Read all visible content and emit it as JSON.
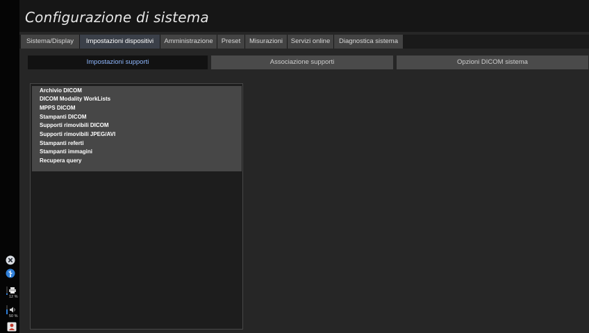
{
  "window": {
    "title": "Configurazione di sistema"
  },
  "tabs": [
    {
      "label": "Sistema/Display",
      "active": false
    },
    {
      "label": "Impostazioni dispositivi",
      "active": true
    },
    {
      "label": "Amministrazione",
      "active": false
    },
    {
      "label": "Preset",
      "active": false
    },
    {
      "label": "Misurazioni",
      "active": false
    },
    {
      "label": "Servizi online",
      "active": false
    },
    {
      "label": "Diagnostica sistema",
      "active": false
    }
  ],
  "subtabs": [
    {
      "label": "Impostazioni supporti",
      "active": true
    },
    {
      "label": "Associazione supporti",
      "active": false
    },
    {
      "label": "Opzioni DICOM sistema",
      "active": false
    }
  ],
  "media_list": {
    "items": [
      "Archivio DICOM",
      "DICOM Modality WorkLists",
      "MPPS DICOM",
      "Stampanti DICOM",
      "Supporti rimovibili DICOM",
      "Supporti rimovibili JPEG/AVI",
      "Stampanti referti",
      "Stampanti immagini",
      "Recupera query"
    ]
  },
  "sidebar": {
    "printer_level": "12 %",
    "volume_level": "50 %",
    "icons": [
      "close-circle-icon",
      "usb-icon",
      "printer-icon",
      "speaker-icon",
      "power-user-icon"
    ]
  },
  "colors": {
    "background": "#262626",
    "tab": "#434343",
    "tab_active": "#3b4049",
    "subtab_active_text": "#8fb8ff",
    "list_box": "#474747"
  }
}
